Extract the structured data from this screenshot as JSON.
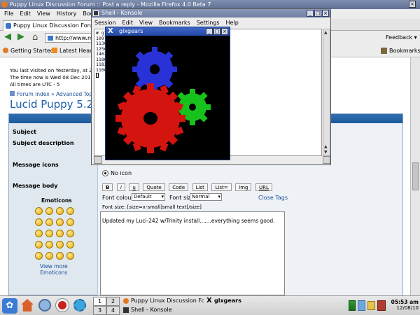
{
  "firefox": {
    "title": "Puppy Linux Discussion Forum :: Post a reply - Mozilla Firefox 4.0 Beta 7",
    "menu": [
      "File",
      "Edit",
      "View",
      "History",
      "Bookmarks"
    ],
    "tab": "Puppy Linux Discussion Forum ...",
    "url": "http://www.m",
    "feedback": "Feedback",
    "bookmarks_bar": [
      "Getting Started",
      "Latest Head"
    ],
    "bookmarks_btn": "Bookmarks"
  },
  "forum": {
    "last_visit": "You last visited on Yesterday, at 23:0",
    "time_now": "The time now is Wed 08 Dec 2010, 0",
    "timezone": "All times are UTC - 5",
    "breadcrumb_index": "Forum index",
    "breadcrumb_sep": "»",
    "breadcrumb_topic": "Advanced Topi",
    "topic_title": "Lucid Puppy 5.2 B",
    "labels": {
      "subject": "Subject",
      "subject_desc": "Subject description",
      "message_icons": "Message icons",
      "message_body": "Message body"
    },
    "no_icon": "No icon",
    "format_buttons": [
      "B",
      "i",
      "u",
      "Quote",
      "Code",
      "List",
      "List=",
      "Img",
      "URL"
    ],
    "font_colour_label": "Font colour:",
    "font_colour_value": "Default",
    "font_size_label": "Font size:",
    "font_size_value": "Normal",
    "close_tags": "Close Tags",
    "font_hint": "Font size: [size=x-small]small text[/size]",
    "emoticons_title": "Emoticons",
    "view_more": "View more",
    "emoticons_word": "Emoticons",
    "message_text": "Updated my Luci-242 w/Trinity install.......everything seems good."
  },
  "konsole": {
    "title": "Shell - Konsole",
    "menu": [
      "Session",
      "Edit",
      "View",
      "Bookmarks",
      "Settings",
      "Help"
    ],
    "lines": [
      "# gl",
      "1097",
      "1130",
      "1256",
      "1462",
      "1186",
      "1183",
      "1166"
    ]
  },
  "glxgears": {
    "title": "glxgears"
  },
  "taskbar": {
    "desktops": [
      "1",
      "2",
      "3",
      "4"
    ],
    "tasks": [
      "Puppy Linux Discussion Forum",
      "glxgears",
      "Shell - Konsole"
    ],
    "clock_time": "05:53 am",
    "clock_date": "12/08/10"
  }
}
